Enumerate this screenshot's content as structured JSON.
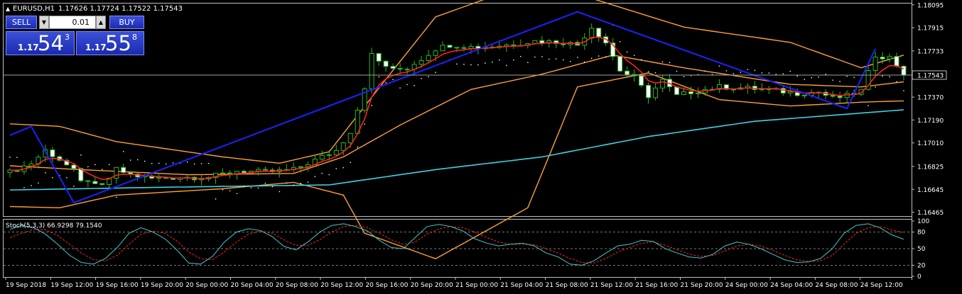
{
  "header": {
    "symbol": "EURUSD,H1",
    "ohlc": "1.17626 1.17724 1.17522 1.17543"
  },
  "trade_panel": {
    "sell_label": "SELL",
    "buy_label": "BUY",
    "lot": "0.01",
    "bid_big": "1.17",
    "bid_main": "54",
    "bid_frac": "3",
    "ask_big": "1.17",
    "ask_main": "55",
    "ask_frac": "8"
  },
  "colors": {
    "background": "#000000",
    "bull": "#22bb22",
    "bear_body": "#ffffff",
    "ma_fast": "#ff2020",
    "bands": "#ffa033",
    "ma_slow": "#40d0e0",
    "zigzag": "#1a22ff",
    "stoch_main": "#40c8d0",
    "stoch_signal": "#ff2020",
    "grid": "#c0c0c0"
  },
  "chart_data": [
    {
      "type": "candlestick",
      "title": "EURUSD,H1",
      "ylim": [
        1.16435,
        1.18105
      ],
      "y_ticks": [
        "1.18095",
        "1.17915",
        "1.17733",
        "1.17543",
        "1.17370",
        "1.17190",
        "1.17010",
        "1.16825",
        "1.16645",
        "1.16465"
      ],
      "current_price": 1.17543,
      "current_price_label": "1.17543",
      "x_ticks": [
        "19 Sep 2018",
        "19 Sep 12:00",
        "19 Sep 16:00",
        "19 Sep 20:00",
        "20 Sep 00:00",
        "20 Sep 04:00",
        "20 Sep 08:00",
        "20 Sep 12:00",
        "20 Sep 16:00",
        "20 Sep 20:00",
        "21 Sep 00:00",
        "21 Sep 04:00",
        "21 Sep 08:00",
        "21 Sep 12:00",
        "21 Sep 16:00",
        "21 Sep 20:00",
        "24 Sep 00:00",
        "24 Sep 04:00",
        "24 Sep 08:00",
        "24 Sep 12:00"
      ],
      "close_knots": [
        [
          0,
          1.1678
        ],
        [
          3,
          1.1685
        ],
        [
          5,
          1.1695
        ],
        [
          7,
          1.1688
        ],
        [
          9,
          1.1679
        ],
        [
          10,
          1.167
        ],
        [
          11,
          1.1672
        ],
        [
          12,
          1.1667
        ],
        [
          13,
          1.1667
        ],
        [
          15,
          1.168
        ],
        [
          17,
          1.1676
        ],
        [
          20,
          1.1673
        ],
        [
          24,
          1.1674
        ],
        [
          28,
          1.1674
        ],
        [
          32,
          1.1679
        ],
        [
          36,
          1.1678
        ],
        [
          40,
          1.168
        ],
        [
          44,
          1.169
        ],
        [
          46,
          1.1695
        ],
        [
          48,
          1.171
        ],
        [
          50,
          1.1745
        ],
        [
          51,
          1.177
        ],
        [
          52,
          1.1765
        ],
        [
          54,
          1.1758
        ],
        [
          56,
          1.176
        ],
        [
          58,
          1.1767
        ],
        [
          60,
          1.1775
        ],
        [
          62,
          1.1778
        ],
        [
          66,
          1.1776
        ],
        [
          70,
          1.1778
        ],
        [
          74,
          1.1781
        ],
        [
          78,
          1.178
        ],
        [
          80,
          1.1778
        ],
        [
          82,
          1.1792
        ],
        [
          84,
          1.178
        ],
        [
          86,
          1.1758
        ],
        [
          88,
          1.1752
        ],
        [
          90,
          1.1738
        ],
        [
          92,
          1.175
        ],
        [
          94,
          1.1738
        ],
        [
          96,
          1.1741
        ],
        [
          100,
          1.1745
        ],
        [
          104,
          1.1744
        ],
        [
          108,
          1.1742
        ],
        [
          111,
          1.174
        ],
        [
          114,
          1.1741
        ],
        [
          116,
          1.1736
        ],
        [
          118,
          1.1738
        ],
        [
          120,
          1.1742
        ],
        [
          122,
          1.177
        ],
        [
          124,
          1.1768
        ],
        [
          126,
          1.1756
        ]
      ],
      "volatility": 0.0004,
      "zigzag": [
        [
          0,
          1.1707
        ],
        [
          3,
          1.1714
        ],
        [
          9,
          1.1654
        ],
        [
          80,
          1.1804
        ],
        [
          118,
          1.1728
        ],
        [
          122,
          1.1775
        ]
      ],
      "ma_slow_knots": [
        [
          0,
          1.1664
        ],
        [
          20,
          1.1666
        ],
        [
          45,
          1.1668
        ],
        [
          60,
          1.168
        ],
        [
          75,
          1.169
        ],
        [
          90,
          1.1706
        ],
        [
          105,
          1.1718
        ],
        [
          126,
          1.1727
        ]
      ],
      "bands_upper_knots": [
        [
          0,
          1.1716
        ],
        [
          7,
          1.1714
        ],
        [
          15,
          1.1702
        ],
        [
          30,
          1.169
        ],
        [
          38,
          1.1685
        ],
        [
          45,
          1.1694
        ],
        [
          52,
          1.1744
        ],
        [
          60,
          1.18
        ],
        [
          70,
          1.182
        ],
        [
          80,
          1.1818
        ],
        [
          95,
          1.1792
        ],
        [
          110,
          1.178
        ],
        [
          120,
          1.176
        ],
        [
          126,
          1.177
        ]
      ],
      "bands_lower_knots": [
        [
          0,
          1.1651
        ],
        [
          7,
          1.165
        ],
        [
          15,
          1.166
        ],
        [
          30,
          1.1665
        ],
        [
          40,
          1.167
        ],
        [
          47,
          1.166
        ],
        [
          50,
          1.163
        ],
        [
          60,
          1.161
        ],
        [
          73,
          1.165
        ],
        [
          80,
          1.1745
        ],
        [
          90,
          1.1756
        ],
        [
          100,
          1.1735
        ],
        [
          110,
          1.173
        ],
        [
          120,
          1.1733
        ],
        [
          126,
          1.1734
        ]
      ],
      "bands_mid_knots": [
        [
          0,
          1.1683
        ],
        [
          10,
          1.168
        ],
        [
          25,
          1.1676
        ],
        [
          40,
          1.1677
        ],
        [
          47,
          1.169
        ],
        [
          55,
          1.1715
        ],
        [
          65,
          1.1743
        ],
        [
          75,
          1.1755
        ],
        [
          85,
          1.177
        ],
        [
          95,
          1.176
        ],
        [
          110,
          1.1747
        ],
        [
          120,
          1.1745
        ],
        [
          126,
          1.1749
        ]
      ],
      "bar_count": 127
    },
    {
      "type": "line",
      "title": "Stoch(5,3,3) 66.9298 79.1540",
      "ylim": [
        0,
        100
      ],
      "y_ticks": [
        "100",
        "80",
        "50",
        "20",
        "0"
      ],
      "levels": [
        80,
        50,
        20
      ],
      "series": [
        {
          "name": "Stoch(5,3,3)",
          "values": [
            85,
            92,
            88,
            76,
            58,
            38,
            25,
            22,
            32,
            52,
            78,
            88,
            80,
            68,
            48,
            24,
            22,
            36,
            62,
            80,
            86,
            83,
            72,
            54,
            48,
            62,
            80,
            92,
            95,
            90,
            82,
            65,
            52,
            50,
            70,
            90,
            94,
            90,
            82,
            68,
            60,
            55,
            58,
            60,
            55,
            42,
            35,
            22,
            20,
            28,
            42,
            55,
            58,
            65,
            63,
            50,
            42,
            35,
            33,
            40,
            55,
            62,
            58,
            50,
            40,
            30,
            25,
            26,
            32,
            50,
            78,
            92,
            95,
            88,
            75,
            67
          ]
        },
        {
          "name": "signal",
          "values": [
            70,
            78,
            85,
            84,
            74,
            58,
            42,
            30,
            28,
            38,
            58,
            76,
            82,
            78,
            64,
            44,
            32,
            30,
            44,
            62,
            76,
            82,
            78,
            66,
            56,
            56,
            66,
            80,
            90,
            92,
            88,
            78,
            66,
            58,
            62,
            76,
            86,
            90,
            88,
            80,
            70,
            62,
            58,
            58,
            57,
            50,
            42,
            32,
            25,
            24,
            32,
            44,
            52,
            60,
            62,
            56,
            48,
            40,
            36,
            38,
            46,
            55,
            58,
            55,
            47,
            38,
            30,
            27,
            28,
            38,
            58,
            78,
            88,
            90,
            84,
            79
          ]
        }
      ]
    }
  ]
}
